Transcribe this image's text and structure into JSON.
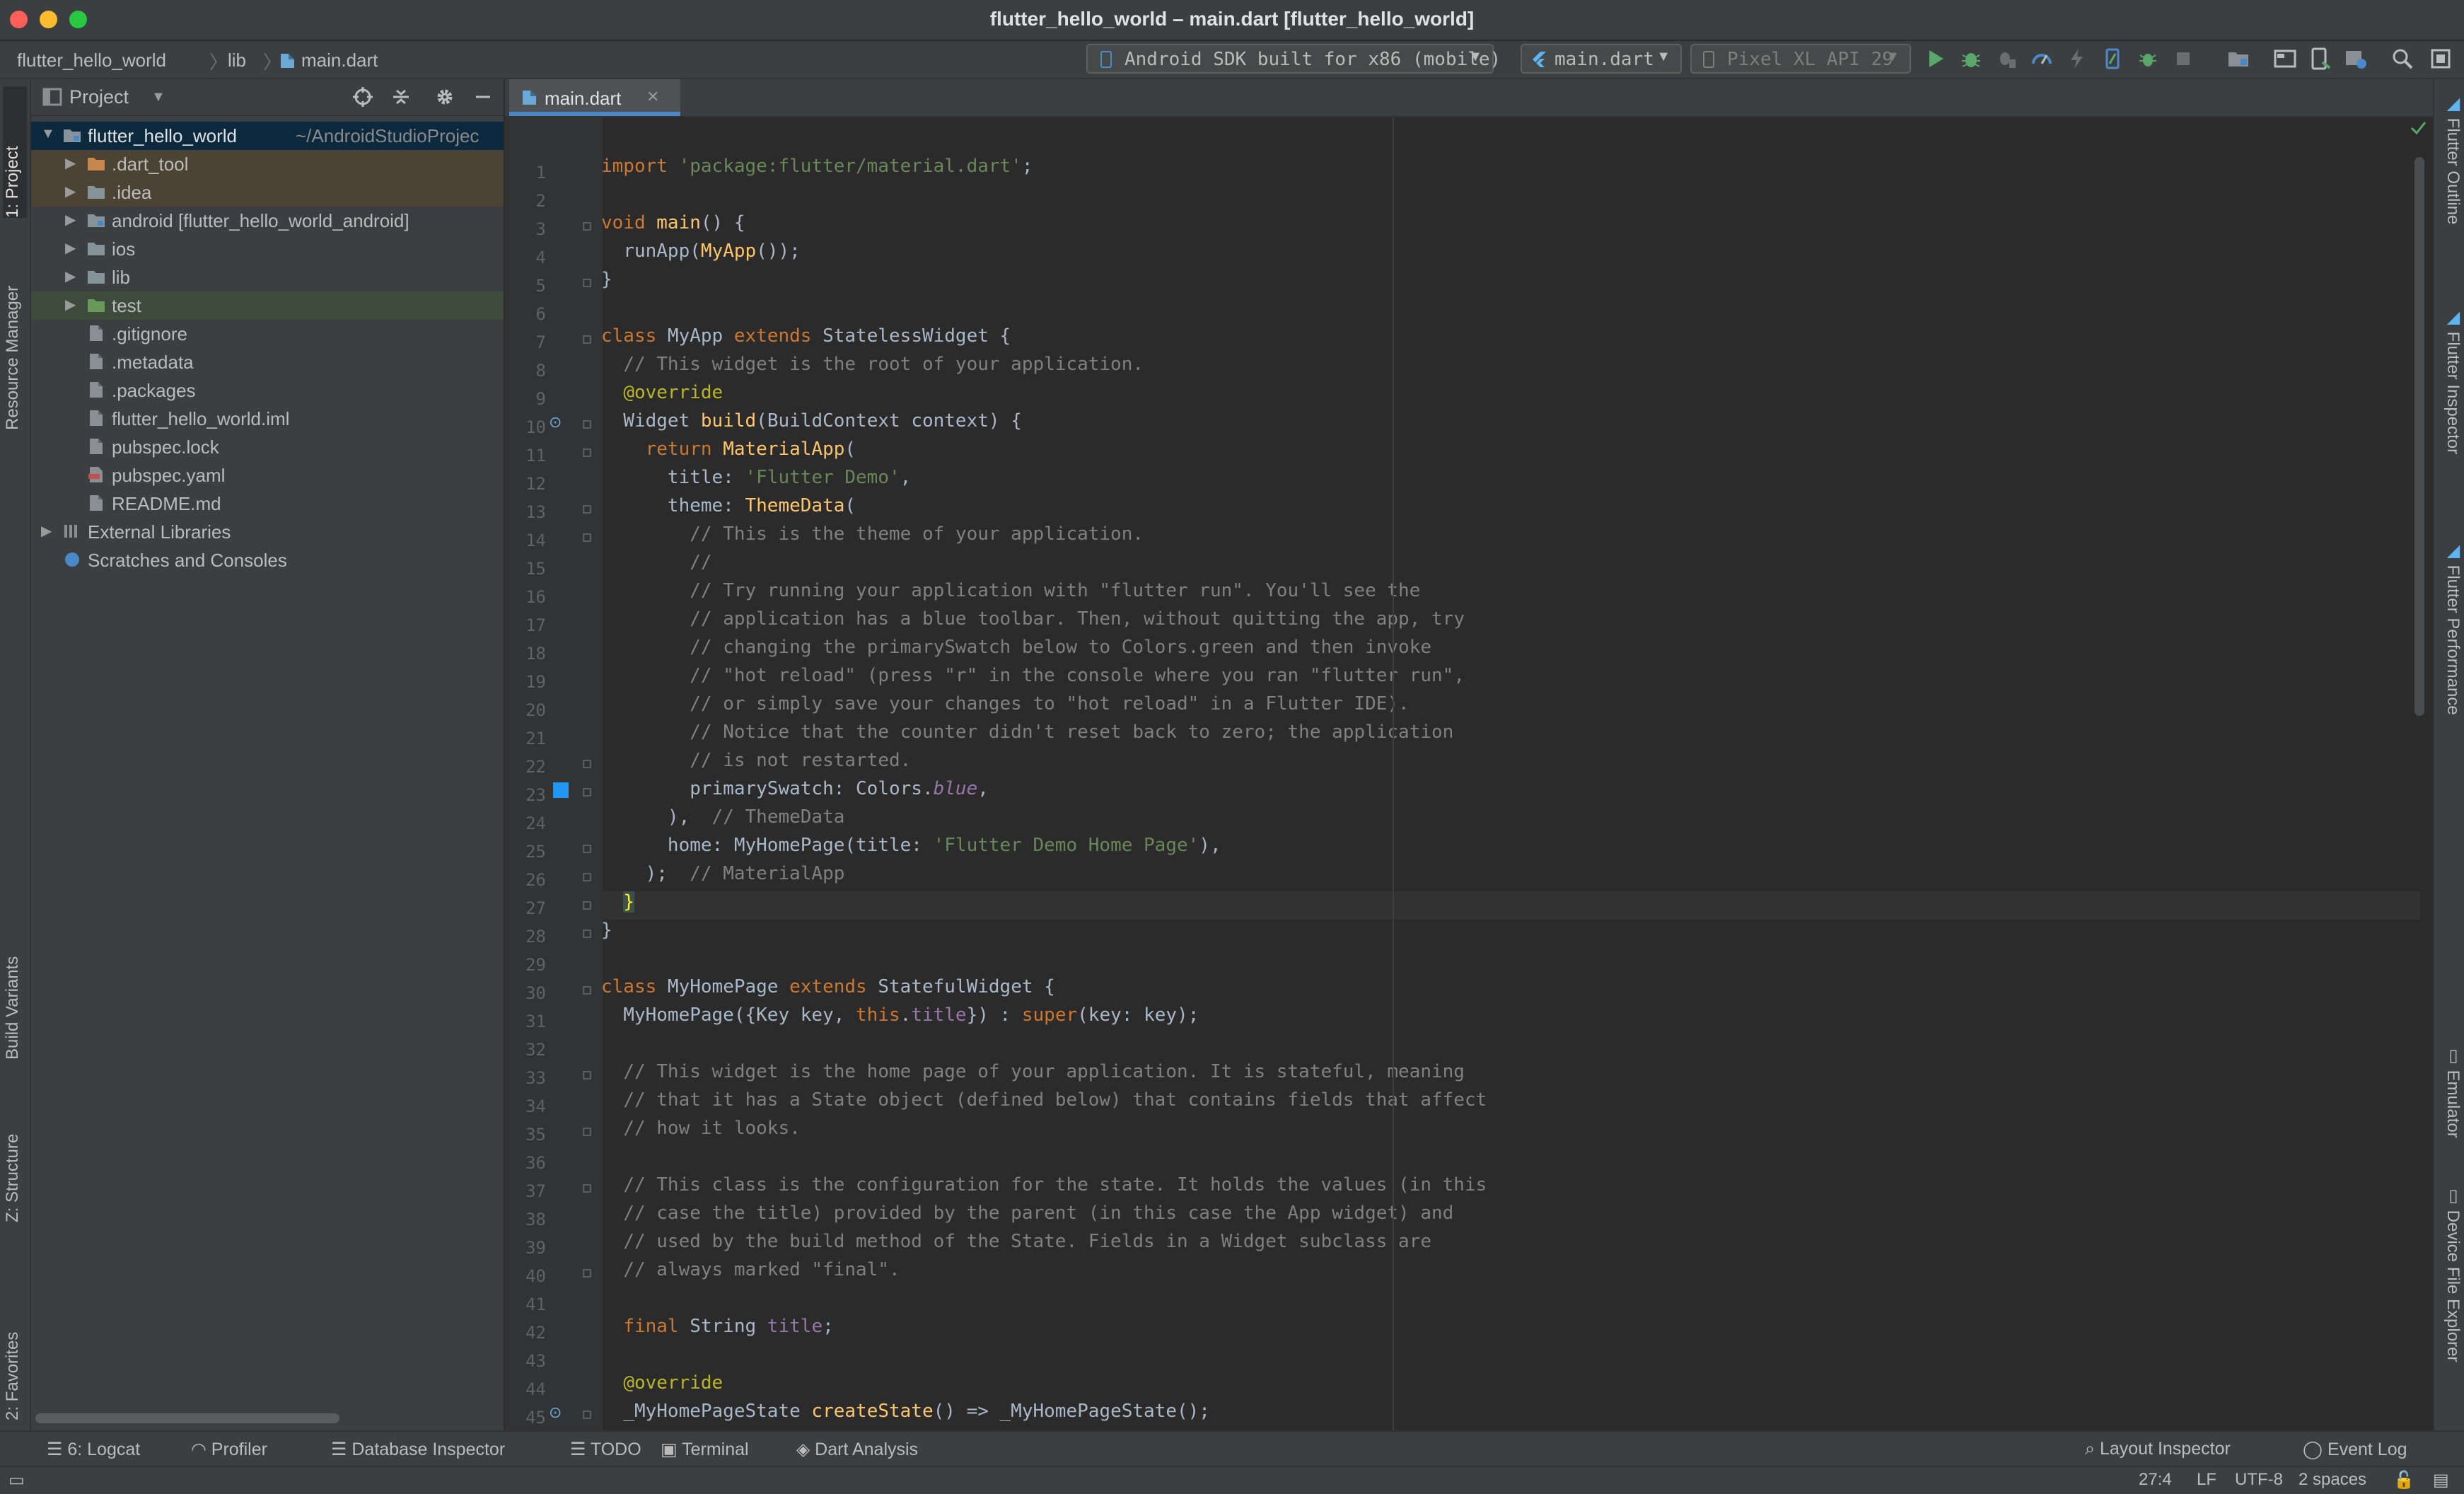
{
  "window": {
    "title": "flutter_hello_world – main.dart [flutter_hello_world]"
  },
  "breadcrumb": [
    "flutter_hello_world",
    "lib",
    "main.dart"
  ],
  "toolbar": {
    "device_combo": "Android SDK built for x86 (mobile)",
    "config_combo": "main.dart",
    "avd_combo": "Pixel XL API 29"
  },
  "project_panel": {
    "title": "Project",
    "tree": [
      {
        "label": "flutter_hello_world",
        "hint": "~/AndroidStudioProjec",
        "icon": "module-folder-icon",
        "expanded": true
      },
      {
        "label": ".dart_tool",
        "icon": "folder-icon"
      },
      {
        "label": ".idea",
        "icon": "folder-icon"
      },
      {
        "label": "android [flutter_hello_world_android]",
        "icon": "module-folder-icon"
      },
      {
        "label": "ios",
        "icon": "folder-icon"
      },
      {
        "label": "lib",
        "icon": "folder-icon"
      },
      {
        "label": "test",
        "icon": "test-folder-icon"
      },
      {
        "label": ".gitignore",
        "icon": "file-icon"
      },
      {
        "label": ".metadata",
        "icon": "file-icon"
      },
      {
        "label": ".packages",
        "icon": "file-icon"
      },
      {
        "label": "flutter_hello_world.iml",
        "icon": "file-icon"
      },
      {
        "label": "pubspec.lock",
        "icon": "file-icon"
      },
      {
        "label": "pubspec.yaml",
        "icon": "yaml-file-icon"
      },
      {
        "label": "README.md",
        "icon": "file-icon"
      },
      {
        "label": "External Libraries",
        "icon": "library-icon"
      },
      {
        "label": "Scratches and Consoles",
        "icon": "scratches-icon"
      }
    ]
  },
  "left_tabs": [
    "1: Project",
    "Resource Manager",
    "Build Variants",
    "Z: Structure",
    "2: Favorites"
  ],
  "right_tabs": [
    "Flutter Outline",
    "Flutter Inspector",
    "Flutter Performance",
    "Emulator",
    "Device File Explorer"
  ],
  "editor": {
    "tab": "main.dart",
    "lines": [
      "import 'package:flutter/material.dart';",
      "",
      "void main() {",
      "  runApp(MyApp());",
      "}",
      "",
      "class MyApp extends StatelessWidget {",
      "  // This widget is the root of your application.",
      "  @override",
      "  Widget build(BuildContext context) {",
      "    return MaterialApp(",
      "      title: 'Flutter Demo',",
      "      theme: ThemeData(",
      "        // This is the theme of your application.",
      "        //",
      "        // Try running your application with \"flutter run\". You'll see the",
      "        // application has a blue toolbar. Then, without quitting the app, try",
      "        // changing the primarySwatch below to Colors.green and then invoke",
      "        // \"hot reload\" (press \"r\" in the console where you ran \"flutter run\",",
      "        // or simply save your changes to \"hot reload\" in a Flutter IDE).",
      "        // Notice that the counter didn't reset back to zero; the application",
      "        // is not restarted.",
      "        primarySwatch: Colors.blue,",
      "      ),  // ThemeData",
      "      home: MyHomePage(title: 'Flutter Demo Home Page'),",
      "    );  // MaterialApp",
      "  }",
      "}",
      "",
      "class MyHomePage extends StatefulWidget {",
      "  MyHomePage({Key key, this.title}) : super(key: key);",
      "",
      "  // This widget is the home page of your application. It is stateful, meaning",
      "  // that it has a State object (defined below) that contains fields that affect",
      "  // how it looks.",
      "",
      "  // This class is the configuration for the state. It holds the values (in this",
      "  // case the title) provided by the parent (in this case the App widget) and",
      "  // used by the build method of the State. Fields in a Widget subclass are",
      "  // always marked \"final\".",
      "",
      "  final String title;",
      "",
      "  @override",
      "  _MyHomePageState createState() => _MyHomePageState();",
      "}"
    ]
  },
  "bottom_tabs": [
    "6: Logcat",
    "Profiler",
    "Database Inspector",
    "TODO",
    "Terminal",
    "Dart Analysis"
  ],
  "bottom_right_tabs": [
    "Layout Inspector",
    "Event Log"
  ],
  "status": {
    "position": "27:4",
    "line_sep": "LF",
    "encoding": "UTF-8",
    "indent": "2 spaces"
  },
  "colors": {
    "accent": "#4a88c7",
    "background": "#2b2b2b",
    "panel": "#3c3f41"
  }
}
